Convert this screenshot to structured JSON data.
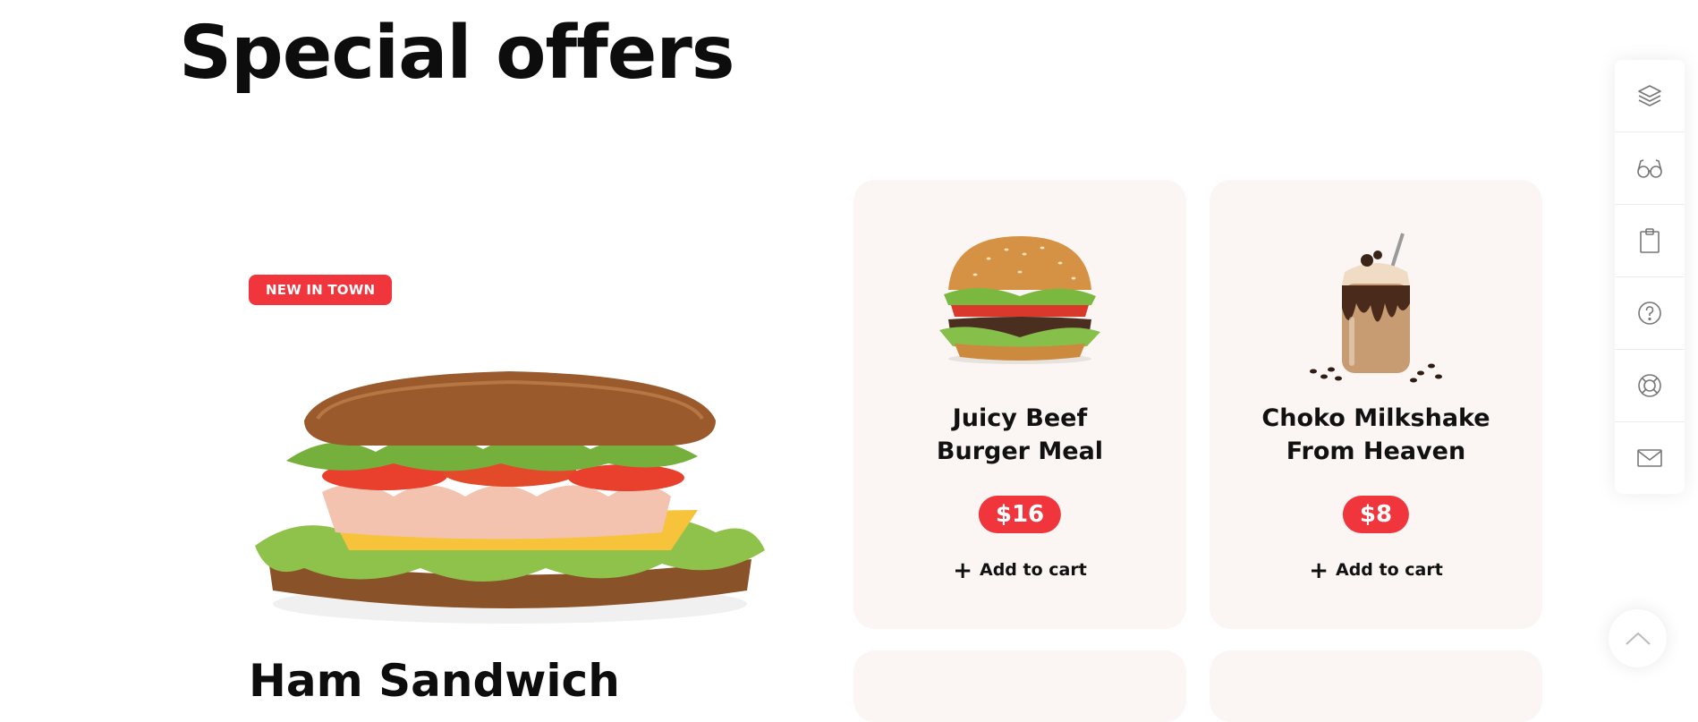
{
  "section": {
    "title": "Special offers"
  },
  "featured": {
    "badge": "NEW IN TOWN",
    "name": "Ham Sandwich",
    "image_icon": "ham-sandwich-image"
  },
  "cards": [
    {
      "name_line1": "Juicy Beef",
      "name_line2": "Burger Meal",
      "price": "$16",
      "cart_label": "Add to cart",
      "image_icon": "burger-image"
    },
    {
      "name_line1": "Choko Milkshake",
      "name_line2": "From Heaven",
      "price": "$8",
      "cart_label": "Add to cart",
      "image_icon": "milkshake-image"
    }
  ],
  "toolbar": {
    "icons": [
      "layers-icon",
      "glasses-icon",
      "clipboard-icon",
      "help-icon",
      "lifebuoy-icon",
      "mail-icon"
    ]
  },
  "scroll_top": {
    "icon": "chevron-up-icon"
  },
  "colors": {
    "accent": "#f0353d",
    "card_bg": "#fbf6f3",
    "text": "#111111"
  }
}
